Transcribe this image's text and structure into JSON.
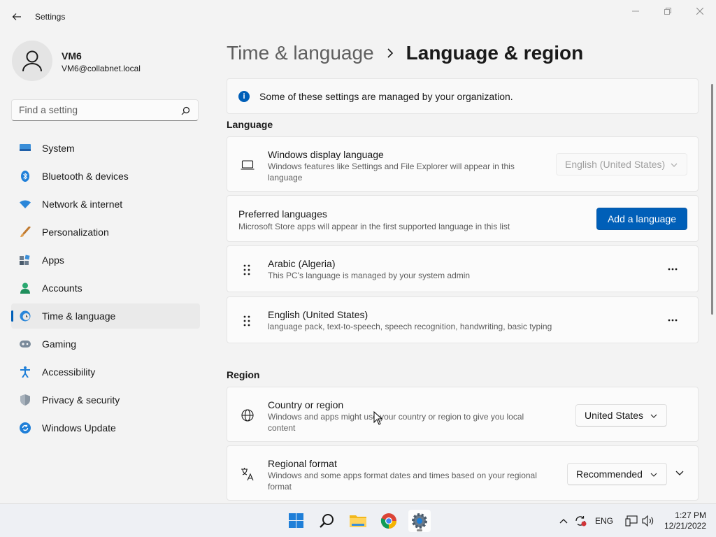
{
  "window": {
    "title": "Settings"
  },
  "profile": {
    "name": "VM6",
    "email": "VM6@collabnet.local"
  },
  "search": {
    "placeholder": "Find a setting"
  },
  "sidebar": {
    "items": [
      {
        "label": "System",
        "icon": "monitor-icon",
        "active": false
      },
      {
        "label": "Bluetooth & devices",
        "icon": "bluetooth-icon",
        "active": false
      },
      {
        "label": "Network & internet",
        "icon": "wifi-icon",
        "active": false
      },
      {
        "label": "Personalization",
        "icon": "paintbrush-icon",
        "active": false
      },
      {
        "label": "Apps",
        "icon": "apps-icon",
        "active": false
      },
      {
        "label": "Accounts",
        "icon": "person-icon",
        "active": false
      },
      {
        "label": "Time & language",
        "icon": "clock-globe-icon",
        "active": true
      },
      {
        "label": "Gaming",
        "icon": "gamepad-icon",
        "active": false
      },
      {
        "label": "Accessibility",
        "icon": "accessibility-icon",
        "active": false
      },
      {
        "label": "Privacy & security",
        "icon": "shield-icon",
        "active": false
      },
      {
        "label": "Windows Update",
        "icon": "update-icon",
        "active": false
      }
    ]
  },
  "breadcrumb": {
    "parent": "Time & language",
    "current": "Language & region"
  },
  "info": {
    "text": "Some of these settings are managed by your organization."
  },
  "language_section": {
    "title": "Language",
    "display_language": {
      "title": "Windows display language",
      "desc": "Windows features like Settings and File Explorer will appear in this language",
      "value": "English (United States)"
    },
    "preferred": {
      "title": "Preferred languages",
      "desc": "Microsoft Store apps will appear in the first supported language in this list",
      "button": "Add a language"
    },
    "languages": [
      {
        "title": "Arabic (Algeria)",
        "desc": "This PC's language is managed by your system admin"
      },
      {
        "title": "English (United States)",
        "desc": "language pack, text-to-speech, speech recognition, handwriting, basic typing"
      }
    ]
  },
  "region_section": {
    "title": "Region",
    "country": {
      "title": "Country or region",
      "desc": "Windows and apps might use your country or region to give you local content",
      "value": "United States"
    },
    "format": {
      "title": "Regional format",
      "desc": "Windows and some apps format dates and times based on your regional format",
      "value": "Recommended"
    }
  },
  "taskbar": {
    "apps": [
      "start-icon",
      "search-icon",
      "file-explorer-icon",
      "chrome-icon",
      "settings-icon"
    ],
    "language": "ENG",
    "time": "1:27 PM",
    "date": "12/21/2022"
  },
  "colors": {
    "accent": "#005fb8",
    "background": "#f3f3f3",
    "card": "#fbfbfb"
  }
}
